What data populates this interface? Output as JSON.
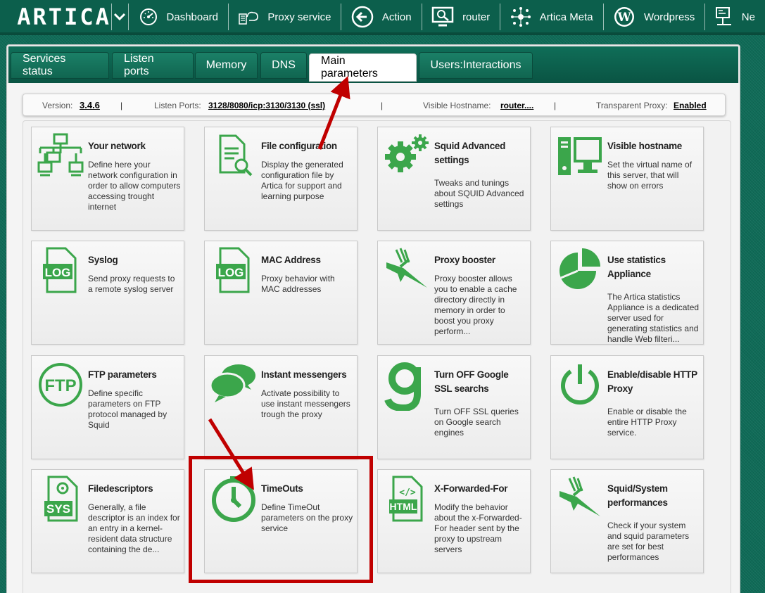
{
  "app": {
    "logo": "ARTICA"
  },
  "nav": {
    "items": [
      {
        "label": "Dashboard",
        "icon": "dashboard-gauge-icon"
      },
      {
        "label": "Proxy service",
        "icon": "proxy-service-icon"
      },
      {
        "label": "Action",
        "icon": "back-arrow-icon"
      },
      {
        "label": "router",
        "icon": "monitor-search-icon"
      },
      {
        "label": "Artica Meta",
        "icon": "meta-network-icon"
      },
      {
        "label": "Wordpress",
        "icon": "wordpress-icon"
      },
      {
        "label": "Ne",
        "icon": "network-icon"
      }
    ]
  },
  "tabs": [
    "Services status",
    "Listen ports",
    "Memory",
    "DNS",
    "Main parameters",
    "Users:Interactions"
  ],
  "active_tab": "Main parameters",
  "infobar": {
    "version_label": "Version:",
    "version_value": "3.4.6",
    "ports_label": "Listen Ports:",
    "ports_value": "3128/8080/icp:3130/3130 (ssl)",
    "hostname_label": "Visible Hostname:",
    "hostname_value": "router....",
    "transparent_label": "Transparent Proxy:",
    "transparent_value": "Enabled",
    "separator": "|"
  },
  "cards": [
    {
      "title": "Your network",
      "desc": "Define here your network configuration in order to allow computers accessing trought internet",
      "icon": "network-topology-icon"
    },
    {
      "title": "File configuration",
      "desc": "Display the generated configuration file by Artica for support and learning purpose",
      "icon": "file-search-icon"
    },
    {
      "title": "Squid Advanced settings",
      "desc": "Tweaks and tunings about SQUID Advanced settings",
      "icon": "gears-icon"
    },
    {
      "title": "Visible hostname",
      "desc": "Set the virtual name of this server, that will show on errors",
      "icon": "computer-icon"
    },
    {
      "title": "Syslog",
      "desc": "Send proxy requests to a remote syslog server",
      "icon": "log-file-icon"
    },
    {
      "title": "MAC Address",
      "desc": "Proxy behavior with MAC addresses",
      "icon": "log-file-icon"
    },
    {
      "title": "Proxy booster",
      "desc": "Proxy booster allows you to enable a cache directory directly in memory in order to boost you proxy perform...",
      "icon": "jet-plane-icon"
    },
    {
      "title": "Use statistics Appliance",
      "desc": "The Artica statistics Appliance is a dedicated server used for generating statistics and handle Web filteri...",
      "icon": "pie-chart-icon"
    },
    {
      "title": "FTP parameters",
      "desc": "Define specific parameters on FTP protocol managed by Squid",
      "icon": "ftp-icon"
    },
    {
      "title": "Instant messengers",
      "desc": "Activate possibility to use instant messengers trough the proxy",
      "icon": "chat-bubbles-icon"
    },
    {
      "title": "Turn OFF Google SSL searchs",
      "desc": "Turn OFF SSL queries on Google search engines",
      "icon": "google-g-icon"
    },
    {
      "title": "Enable/disable HTTP Proxy",
      "desc": "Enable or disable the entire HTTP Proxy service.",
      "icon": "power-icon"
    },
    {
      "title": "Filedescriptors",
      "desc": "Generally, a file descriptor is an index for an entry in a kernel-resident data structure containing the de...",
      "icon": "sys-file-icon"
    },
    {
      "title": "TimeOuts",
      "desc": "Define TimeOut parameters on the proxy service",
      "icon": "clock-icon"
    },
    {
      "title": "X-Forwarded-For",
      "desc": "Modify the behavior about the x-Forwarded-For header sent by the proxy to upstream servers",
      "icon": "html-file-icon"
    },
    {
      "title": "Squid/System performances",
      "desc": "Check if your system and squid parameters are set for best performances",
      "icon": "jet-plane-icon"
    }
  ],
  "colors": {
    "icon_green": "#3ba64b",
    "nav_bg": "#0c5f4c",
    "highlight_red": "#c00000"
  }
}
